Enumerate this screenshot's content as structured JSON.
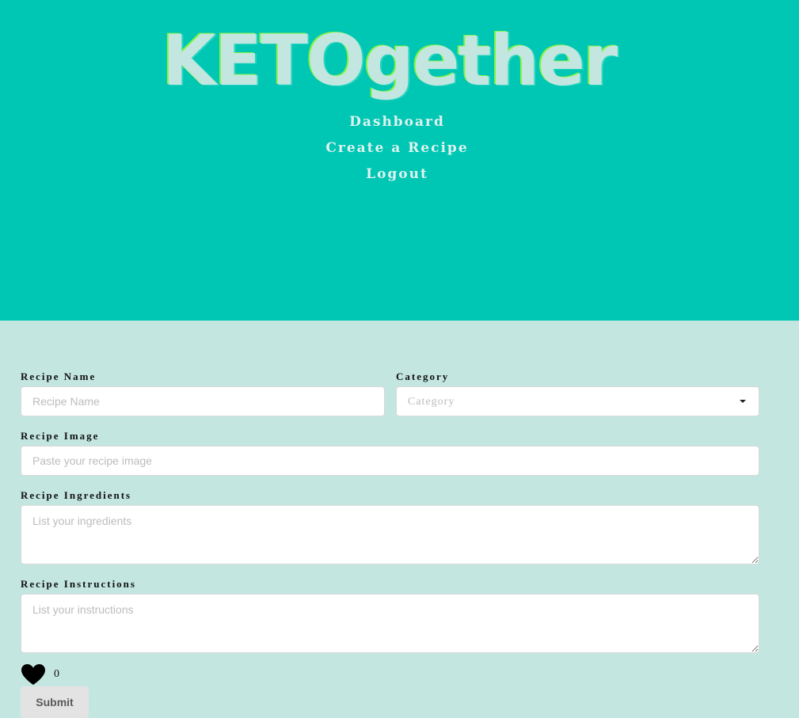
{
  "header": {
    "brand": "KETOgether",
    "nav": [
      {
        "label": "Dashboard"
      },
      {
        "label": "Create a Recipe"
      },
      {
        "label": "Logout"
      }
    ]
  },
  "form": {
    "recipe_name": {
      "label": "Recipe Name",
      "placeholder": "Recipe Name",
      "value": ""
    },
    "category": {
      "label": "Category",
      "selected": "Category"
    },
    "recipe_image": {
      "label": "Recipe Image",
      "placeholder": "Paste your recipe image",
      "value": ""
    },
    "ingredients": {
      "label": "Recipe Ingredients",
      "placeholder": "List your ingredients",
      "value": ""
    },
    "instructions": {
      "label": "Recipe Instructions",
      "placeholder": "List your instructions",
      "value": ""
    },
    "likes": {
      "count": "0",
      "icon": "heart-icon"
    },
    "submit_label": "Submit"
  },
  "colors": {
    "header_bg": "#00c6b4",
    "page_bg": "#c4e6e0"
  }
}
